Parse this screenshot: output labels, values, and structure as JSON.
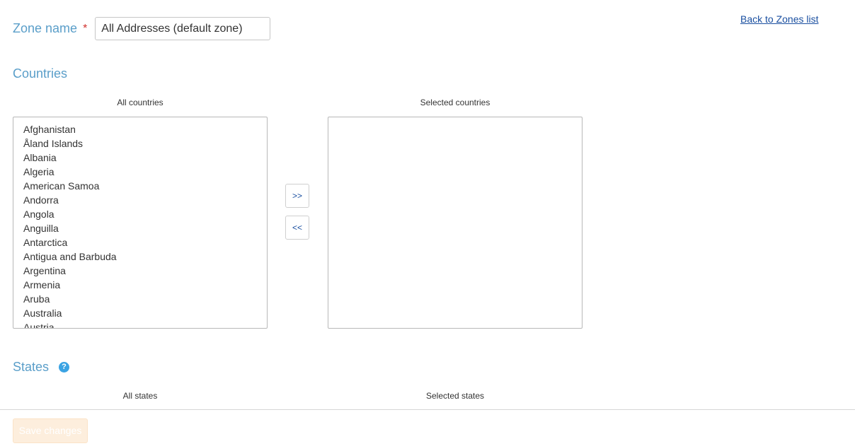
{
  "zone": {
    "label": "Zone name",
    "required_mark": "*",
    "value": "All Addresses (default zone)"
  },
  "back_link": "Back to Zones list",
  "countries": {
    "title": "Countries",
    "all_caption": "All countries",
    "selected_caption": "Selected countries",
    "all_items": [
      "Afghanistan",
      "Åland Islands",
      "Albania",
      "Algeria",
      "American Samoa",
      "Andorra",
      "Angola",
      "Anguilla",
      "Antarctica",
      "Antigua and Barbuda",
      "Argentina",
      "Armenia",
      "Aruba",
      "Australia",
      "Austria"
    ],
    "selected_items": [],
    "add_label": ">>",
    "remove_label": "<<"
  },
  "states": {
    "title": "States",
    "help_icon_glyph": "?",
    "all_caption": "All states",
    "selected_caption": "Selected states"
  },
  "footer": {
    "save_label": "Save changes"
  },
  "colors": {
    "section_title": "#5a9ec9",
    "link": "#1a4fa0",
    "required": "#d0312d",
    "help_icon": "#3aa3e3",
    "save_button_disabled_bg": "#fdeedd"
  },
  "icons": {
    "help": "help-circle-icon"
  }
}
